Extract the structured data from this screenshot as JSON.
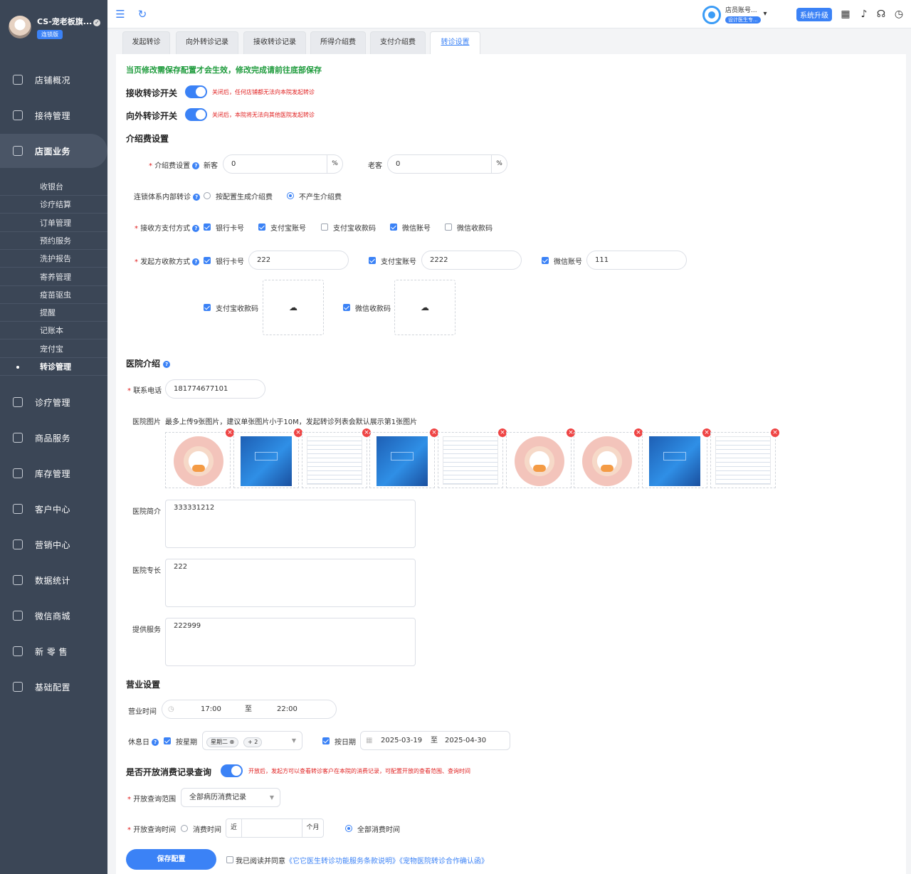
{
  "sidebar": {
    "shop_name": "CS-宠老板旗...",
    "edition": "连锁版",
    "menu": [
      {
        "label": "店铺概况",
        "icon": "monitor-icon"
      },
      {
        "label": "接待管理",
        "icon": "reception-icon"
      },
      {
        "label": "店面业务",
        "icon": "store-icon"
      },
      {
        "label": "诊疗管理",
        "icon": "medical-icon"
      },
      {
        "label": "商品服务",
        "icon": "goods-icon"
      },
      {
        "label": "库存管理",
        "icon": "inventory-icon"
      },
      {
        "label": "客户中心",
        "icon": "customer-icon"
      },
      {
        "label": "营销中心",
        "icon": "marketing-icon"
      },
      {
        "label": "数据统计",
        "icon": "statistics-icon"
      },
      {
        "label": "微信商城",
        "icon": "wechat-mall-icon"
      },
      {
        "label": "新 零 售",
        "icon": "retail-icon"
      },
      {
        "label": "基础配置",
        "icon": "settings-icon"
      }
    ],
    "submenu": [
      "收银台",
      "诊疗结算",
      "订单管理",
      "预约服务",
      "洗护报告",
      "寄养管理",
      "疫苗驱虫",
      "提醒",
      "记账本",
      "宠付宝",
      "转诊管理"
    ]
  },
  "header": {
    "account_name": "店员账号...",
    "account_tag": "设计医生专...",
    "upgrade_label": "系统升级"
  },
  "tabs": [
    "发起转诊",
    "向外转诊记录",
    "接收转诊记录",
    "所得介绍费",
    "支付介绍费",
    "转诊设置"
  ],
  "form": {
    "notice": "当页修改需保存配置才会生效，修改完成请前往底部保存",
    "receive_switch_label": "接收转诊开关",
    "receive_switch_hint": "关闭后，任何店铺都无法向本院发起转诊",
    "outgoing_switch_label": "向外转诊开关",
    "outgoing_switch_hint": "关闭后，本院将无法向其他医院发起转诊",
    "fee_section": "介绍费设置",
    "fee_label": "介绍费设置",
    "new_label": "新客",
    "new_value": "0",
    "old_label": "老客",
    "old_value": "0",
    "percent": "%",
    "chain_label": "连锁体系内部转诊",
    "chain_opt1": "按配置生成介绍费",
    "chain_opt2": "不产生介绍费",
    "recv_pay_label": "接收方支付方式",
    "recv_pay_opts": [
      "银行卡号",
      "支付宝账号",
      "支付宝收款码",
      "微信账号",
      "微信收款码"
    ],
    "send_recv_label": "发起方收款方式",
    "bank_label": "银行卡号",
    "bank_value": "222",
    "alipay_label": "支付宝账号",
    "alipay_value": "2222",
    "wechat_label": "微信账号",
    "wechat_value": "111",
    "alipay_qr_label": "支付宝收款码",
    "wechat_qr_label": "微信收款码",
    "hospital_section": "医院介绍",
    "phone_label": "联系电话",
    "phone_value": "181774677101",
    "pics_label": "医院图片",
    "pics_hint": "最多上传9张图片，建议单张图片小于10M，发起转诊列表会默认展示第1张图片",
    "intro_label": "医院简介",
    "intro_value": "333331212",
    "specialty_label": "医院专长",
    "specialty_value": "222",
    "service_label": "提供服务",
    "service_value": "222999",
    "biz_section": "营业设置",
    "hours_label": "营业时间",
    "hours_start": "17:00",
    "hours_to": "至",
    "hours_end": "22:00",
    "rest_label": "休息日",
    "by_week_label": "按星期",
    "week_tag": "星期二",
    "week_more": "+ 2",
    "by_date_label": "按日期",
    "date_start": "2025-03-19",
    "date_to": "至",
    "date_end": "2025-04-30",
    "consume_label": "是否开放消费记录查询",
    "consume_hint": "开放后，发起方可以查看转诊客户在本院的消费记录，可配置开放的查看范围、查询时间",
    "scope_label": "开放查询范围",
    "scope_value": "全部病历消费记录",
    "time_label": "开放查询时间",
    "time_opt1": "消费时间",
    "near": "近",
    "months": "个月",
    "time_opt2": "全部消费时间",
    "save_label": "保存配置",
    "agree_text": "我已阅读并同意",
    "agree_link1": "《它它医生转诊功能服务条款说明》",
    "agree_link2": "《宠物医院转诊合作确认函》"
  }
}
